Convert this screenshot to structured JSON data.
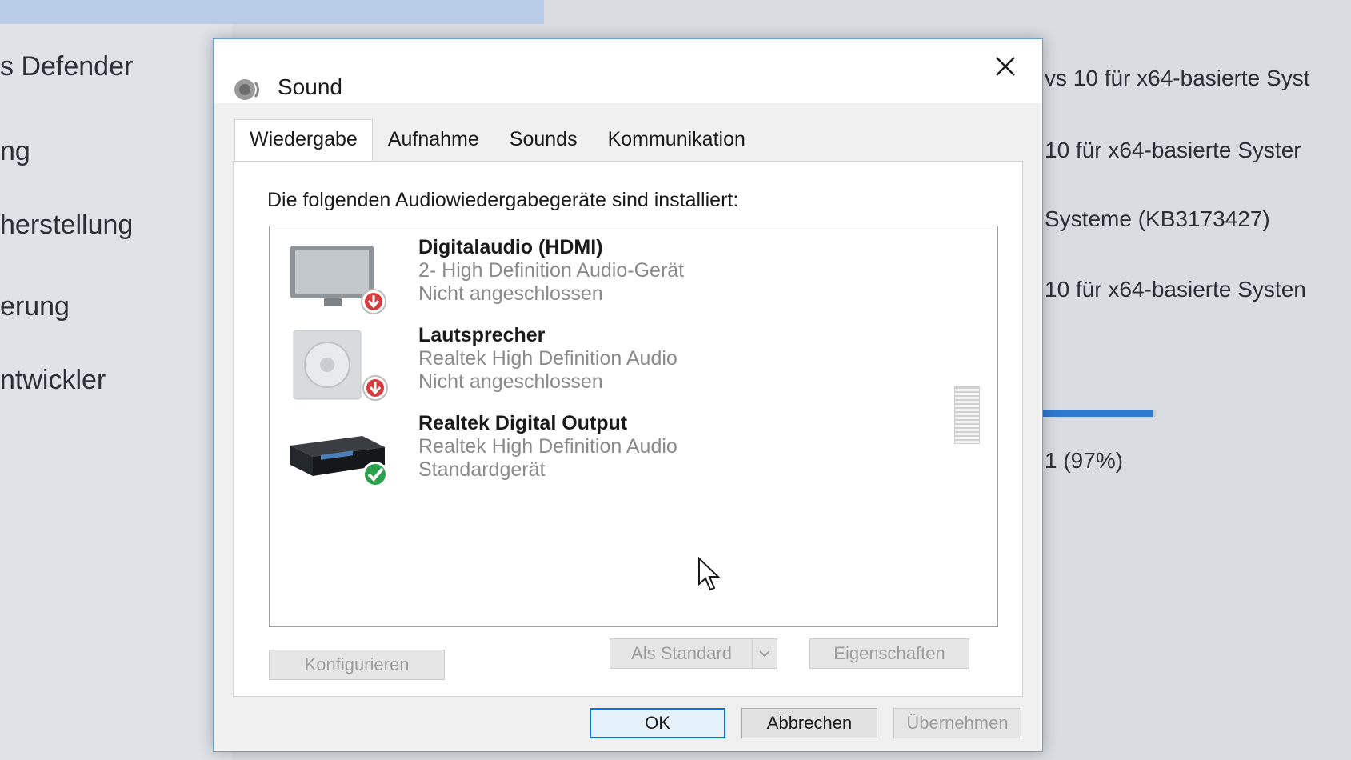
{
  "background": {
    "nav_items": [
      "s Defender",
      "ng",
      "herstellung",
      "erung",
      "ntwickler"
    ],
    "update_lines": [
      "vs 10 für x64-basierte Syst",
      "10 für x64-basierte Syster",
      "Systeme (KB3173427)",
      "10 für x64-basierte Systen"
    ],
    "progress_percent": 97,
    "progress_label": "1 (97%)"
  },
  "dialog": {
    "title": "Sound",
    "tabs": [
      {
        "label": "Wiedergabe",
        "active": true
      },
      {
        "label": "Aufnahme",
        "active": false
      },
      {
        "label": "Sounds",
        "active": false
      },
      {
        "label": "Kommunikation",
        "active": false
      }
    ],
    "instruction": "Die folgenden Audiowiedergabegeräte sind installiert:",
    "devices": [
      {
        "name": "Digitalaudio (HDMI)",
        "driver": "2- High Definition Audio-Gerät",
        "status": "Nicht angeschlossen",
        "icon": "monitor-icon",
        "badge": "disconnected-icon"
      },
      {
        "name": "Lautsprecher",
        "driver": "Realtek High Definition Audio",
        "status": "Nicht angeschlossen",
        "icon": "speaker-icon",
        "badge": "disconnected-icon"
      },
      {
        "name": "Realtek Digital Output",
        "driver": "Realtek High Definition Audio",
        "status": "Standardgerät",
        "icon": "receiver-icon",
        "badge": "default-checkmark-icon"
      }
    ],
    "buttons": {
      "configure": "Konfigurieren",
      "set_default": "Als Standard",
      "properties": "Eigenschaften",
      "ok": "OK",
      "cancel": "Abbrechen",
      "apply": "Übernehmen"
    }
  },
  "colors": {
    "accent": "#0078d7",
    "dialog_border": "#6e9ed6",
    "disconnected": "#d83b3b",
    "default_ok": "#2aa14a"
  }
}
